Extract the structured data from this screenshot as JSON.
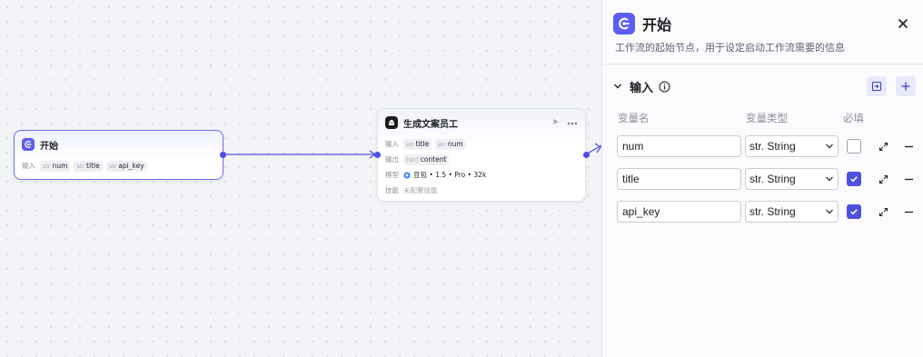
{
  "canvas": {
    "start_node": {
      "title": "开始",
      "input_label": "输入",
      "inputs": [
        {
          "type": "str",
          "name": "num"
        },
        {
          "type": "str",
          "name": "title"
        },
        {
          "type": "str",
          "name": "api_key"
        }
      ]
    },
    "llm_node": {
      "title": "生成文案员工",
      "input_label": "输入",
      "inputs": [
        {
          "type": "str",
          "name": "title"
        },
        {
          "type": "str",
          "name": "num"
        }
      ],
      "output_label": "输出",
      "outputs": [
        {
          "type": "[str]",
          "name": "content"
        }
      ],
      "model_label": "模型",
      "model_value": "豆包 • 1.5 • Pro • 32k",
      "skill_label": "技能",
      "skill_value": "未配置技能"
    }
  },
  "panel": {
    "title": "开始",
    "description": "工作流的起始节点，用于设定启动工作流需要的信息",
    "section_title": "输入",
    "columns": {
      "name": "变量名",
      "type": "变量类型",
      "required": "必填"
    },
    "variables": [
      {
        "name": "num",
        "type": "str. String",
        "required": false
      },
      {
        "name": "title",
        "type": "str. String",
        "required": true
      },
      {
        "name": "api_key",
        "type": "str. String",
        "required": true
      }
    ]
  },
  "colors": {
    "accent": "#4e50e0",
    "node_icon": "#5b5ef4"
  },
  "icons": {
    "node": "workflow-start-icon",
    "close": "close-icon",
    "collapse": "chevron-down-icon",
    "info": "info-icon",
    "import": "import-icon",
    "add": "plus-icon",
    "expand": "expand-icon",
    "remove": "minus-icon"
  }
}
